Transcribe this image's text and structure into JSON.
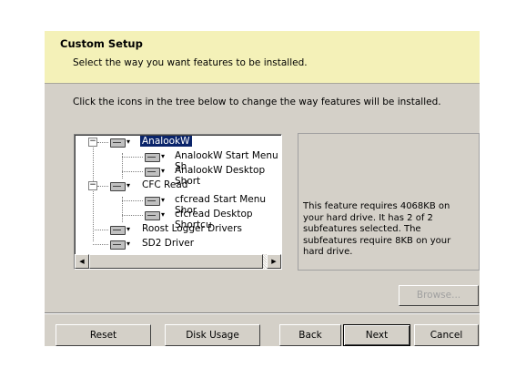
{
  "header": {
    "title": "Custom Setup",
    "subtitle": "Select the way you want features to be installed."
  },
  "instructions": "Click the icons in the tree below to change the way features will be installed.",
  "tree": {
    "items": [
      {
        "label": "AnalookW",
        "selected": true,
        "level": 0,
        "expanded": true
      },
      {
        "label": "AnalookW Start Menu Sh",
        "level": 1
      },
      {
        "label": "AnalookW Desktop Short",
        "level": 1
      },
      {
        "label": "CFC Read",
        "level": 0,
        "expanded": true
      },
      {
        "label": "cfcread Start Menu Shor",
        "level": 1
      },
      {
        "label": "cfcread Desktop Shortcu",
        "level": 1
      },
      {
        "label": "Roost Logger Drivers",
        "level": 0
      },
      {
        "label": "SD2 Driver",
        "level": 0
      }
    ],
    "expander_minus": "−",
    "drive_arrow": "▾",
    "scroll_left": "◀",
    "scroll_right": "▶"
  },
  "description": "This feature requires 4068KB on your hard drive. It has 2 of 2 subfeatures selected. The subfeatures require 8KB on your hard drive.",
  "browse_label": "Browse...",
  "buttons": {
    "reset": "Reset",
    "disk_usage": "Disk Usage",
    "back": "Back",
    "next": "Next",
    "cancel": "Cancel"
  },
  "colors": {
    "header_bg": "#f4f1b8",
    "dialog_bg": "#d4d0c8",
    "selection": "#0a246a"
  }
}
